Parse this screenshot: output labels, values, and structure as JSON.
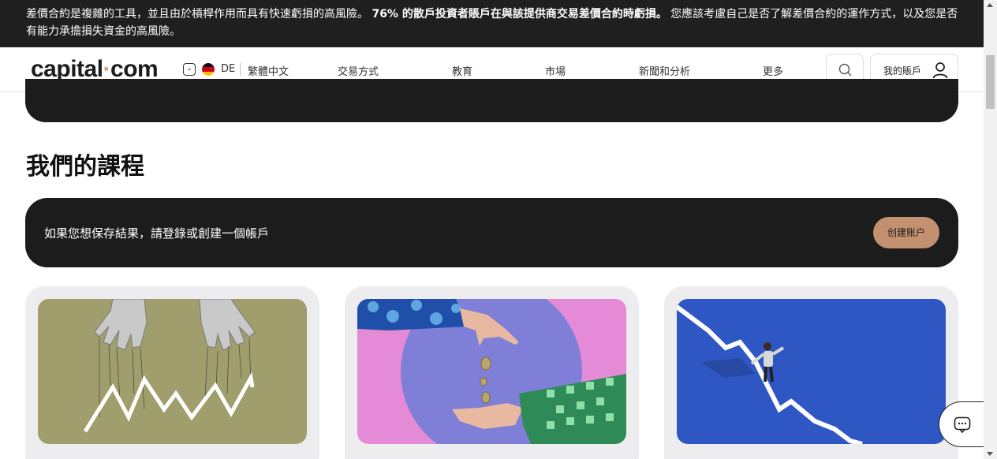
{
  "risk_banner": {
    "part1": "差價合約是複雜的工具，並且由於槓桿作用而具有快速虧損的高風險。",
    "bold": "76% 的散戶投資者賬戶在與該提供商交易差價合約時虧損。",
    "part2": "您應該考慮自己是否了解差價合約的運作方式，以及您是否有能力承擔損失資金的高風險。"
  },
  "header": {
    "logo_left": "capital",
    "logo_dot": "·",
    "logo_right": "com",
    "lang_toggle_icon": "chevron-down-icon",
    "country_code": "DE",
    "language": "繁體中文",
    "nav": [
      "交易方式",
      "教育",
      "市場",
      "新聞和分析",
      "更多"
    ],
    "search_icon": "search-icon",
    "account_label": "我的賬戶",
    "account_icon": "user-icon"
  },
  "section": {
    "title": "我們的課程"
  },
  "login_prompt": {
    "text": "如果您想保存結果，請登錄或創建一個帳戶",
    "button": "创建账户"
  },
  "courses": [
    {
      "image": "puppet-hands-chart",
      "bg": "#a09e6c"
    },
    {
      "image": "coins-dropping-hands",
      "bg": "#e48ad6"
    },
    {
      "image": "man-on-falling-chart",
      "bg": "#2f57c4"
    }
  ],
  "colors": {
    "accent": "#c49170",
    "dark": "#1c1c1c",
    "card_bg": "#ededef"
  },
  "chat": {
    "icon": "chat-icon"
  }
}
